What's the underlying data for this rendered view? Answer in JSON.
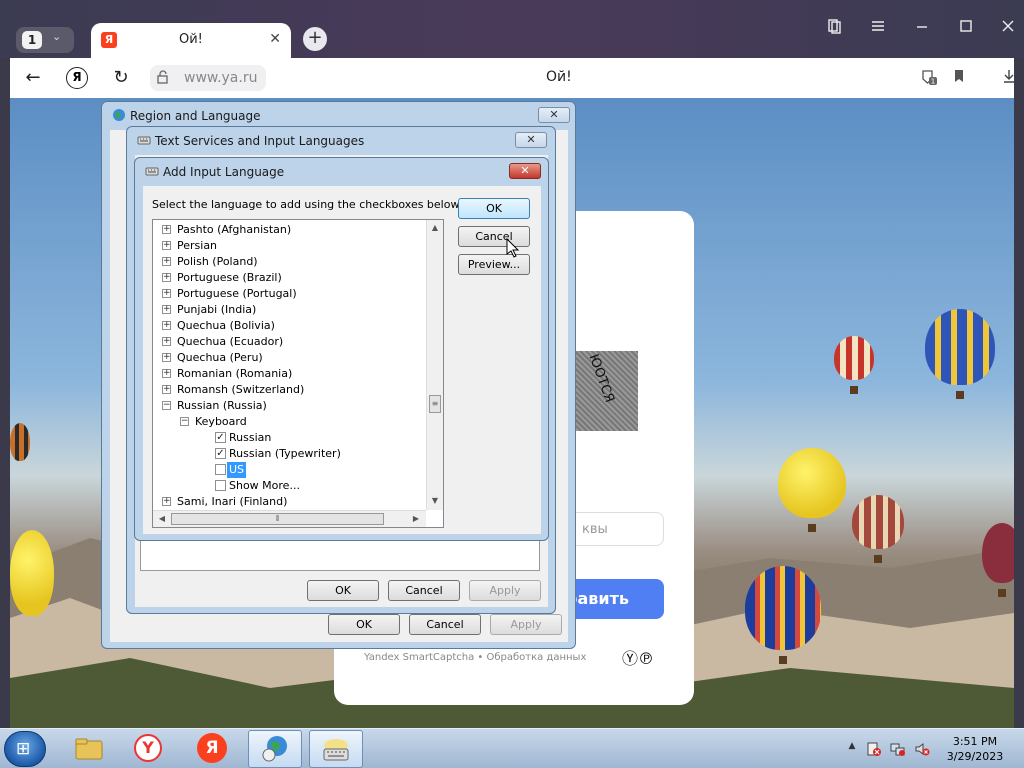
{
  "browser": {
    "tab_count": "1",
    "tab_count_chevron": "⌄",
    "tab_favicon": "Я",
    "tab_title": "Ой!",
    "tab_close": "✕",
    "new_tab": "+",
    "url": "www.ya.ru",
    "page_title": "Ой!",
    "back": "←",
    "reload": "↻",
    "ya_button": "Я",
    "accent_color": "#fc3f1d"
  },
  "captcha": {
    "image_text": "ЮОТСЯ",
    "input_placeholder_fragment": "квы",
    "submit_fragment": "равить",
    "footer": "Yandex SmartCaptcha • Обработка данных",
    "logo": "Ⓨ℗"
  },
  "region_window": {
    "title": "Region and Language",
    "close": "✕",
    "ok": "OK",
    "cancel": "Cancel",
    "apply": "Apply"
  },
  "text_services_window": {
    "title": "Text Services and Input Languages",
    "close": "✕",
    "ok": "OK",
    "cancel": "Cancel",
    "apply": "Apply"
  },
  "add_language_dialog": {
    "title": "Add Input Language",
    "close": "✕",
    "instruction": "Select the language to add using the checkboxes below.",
    "ok": "OK",
    "cancel": "Cancel",
    "preview": "Preview...",
    "tree": [
      {
        "label": "Pashto (Afghanistan)",
        "expander": "+"
      },
      {
        "label": "Persian",
        "expander": "+"
      },
      {
        "label": "Polish (Poland)",
        "expander": "+"
      },
      {
        "label": "Portuguese (Brazil)",
        "expander": "+"
      },
      {
        "label": "Portuguese (Portugal)",
        "expander": "+"
      },
      {
        "label": "Punjabi (India)",
        "expander": "+"
      },
      {
        "label": "Quechua (Bolivia)",
        "expander": "+"
      },
      {
        "label": "Quechua (Ecuador)",
        "expander": "+"
      },
      {
        "label": "Quechua (Peru)",
        "expander": "+"
      },
      {
        "label": "Romanian (Romania)",
        "expander": "+"
      },
      {
        "label": "Romansh (Switzerland)",
        "expander": "+"
      },
      {
        "label": "Russian (Russia)",
        "expander": "−"
      },
      {
        "label": "Keyboard",
        "expander": "−"
      },
      {
        "label": "Russian",
        "checked": "✓"
      },
      {
        "label": "Russian (Typewriter)",
        "checked": "✓"
      },
      {
        "label": "US",
        "checked": ""
      },
      {
        "label": "Show More...",
        "checked": ""
      },
      {
        "label": "Sami, Inari (Finland)",
        "expander": "+"
      }
    ],
    "scroll_up": "▲",
    "scroll_down": "▼",
    "scroll_left": "◀",
    "scroll_right": "▶",
    "scroll_grip_v": "≡",
    "scroll_grip_h": "⦀"
  },
  "taskbar": {
    "start_glyph": "⊞",
    "time": "3:51 PM",
    "date": "3/29/2023",
    "tray_arrow": "▲",
    "yandex_label": "Я",
    "yandex_browser_label": "Y"
  }
}
